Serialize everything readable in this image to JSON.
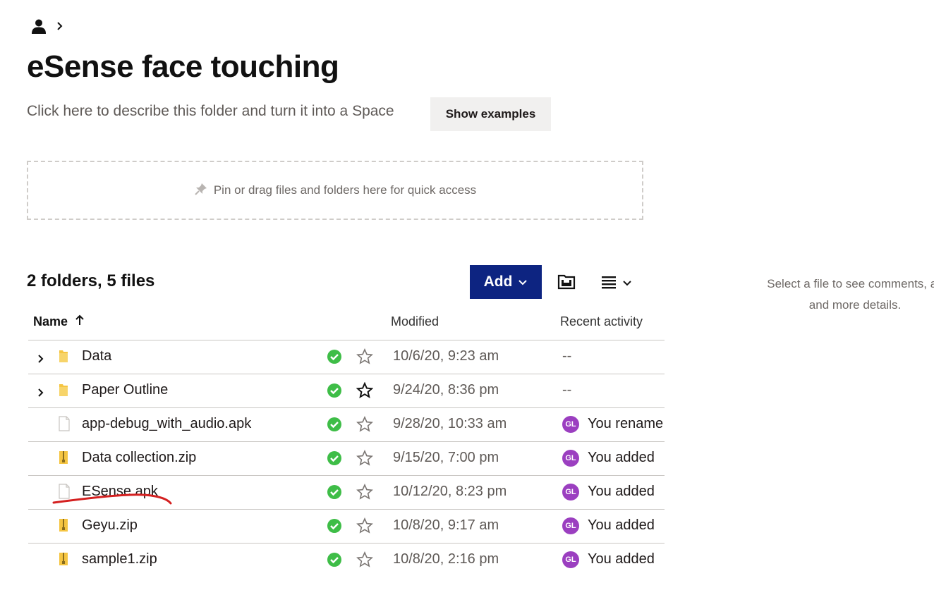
{
  "breadcrumb": {
    "user_icon": "user-icon",
    "separator_icon": "chevron-right-icon"
  },
  "page": {
    "title": "eSense face touching",
    "description_placeholder": "Click here to describe this folder and turn it into a Space",
    "show_examples_label": "Show examples"
  },
  "pin_area": {
    "icon": "pin-icon",
    "text": "Pin or drag files and folders here for quick access"
  },
  "toolbar": {
    "count_label": "2 folders, 5 files",
    "add_label": "Add",
    "add_icon": "chevron-down-icon",
    "folder_icon": "folder-save-icon",
    "view_icon": "list-view-icon"
  },
  "side_panel": {
    "hint_line1": "Select a file to see comments, ac",
    "hint_line2": "and more details."
  },
  "table": {
    "columns": {
      "name": "Name",
      "modified": "Modified",
      "activity": "Recent activity"
    },
    "rows": [
      {
        "name": "Data",
        "type": "folder",
        "expandable": true,
        "starred": false,
        "modified": "10/6/20, 9:23 am",
        "activity": "--",
        "avatar": ""
      },
      {
        "name": "Paper Outline",
        "type": "folder",
        "expandable": true,
        "starred": true,
        "modified": "9/24/20, 8:36 pm",
        "activity": "--",
        "avatar": ""
      },
      {
        "name": "app-debug_with_audio.apk",
        "type": "file",
        "expandable": false,
        "starred": false,
        "modified": "9/28/20, 10:33 am",
        "activity": "You rename",
        "avatar": "GL"
      },
      {
        "name": "Data collection.zip",
        "type": "zip",
        "expandable": false,
        "starred": false,
        "modified": "9/15/20, 7:00 pm",
        "activity": "You added",
        "avatar": "GL"
      },
      {
        "name": "ESense.apk",
        "type": "file",
        "expandable": false,
        "starred": false,
        "modified": "10/12/20, 8:23 pm",
        "activity": "You added",
        "avatar": "GL"
      },
      {
        "name": "Geyu.zip",
        "type": "zip",
        "expandable": false,
        "starred": false,
        "modified": "10/8/20, 9:17 am",
        "activity": "You added",
        "avatar": "GL"
      },
      {
        "name": "sample1.zip",
        "type": "zip",
        "expandable": false,
        "starred": false,
        "modified": "10/8/20, 2:16 pm",
        "activity": "You added",
        "avatar": "GL"
      }
    ]
  },
  "colors": {
    "add_button": "#0d2481",
    "sync_ok": "#3ebd47",
    "avatar": "#9b3fc0",
    "annotation": "#d42020"
  }
}
